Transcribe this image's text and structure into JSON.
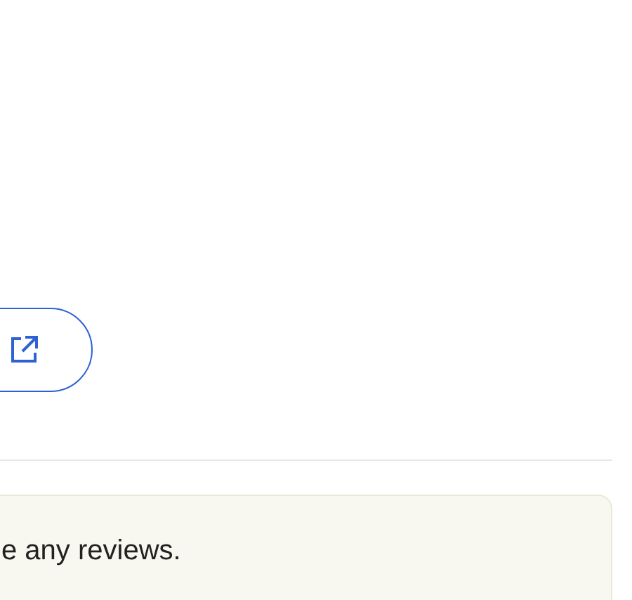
{
  "action_button": {
    "kind": "external-link"
  },
  "notice": {
    "text": "e any reviews."
  }
}
